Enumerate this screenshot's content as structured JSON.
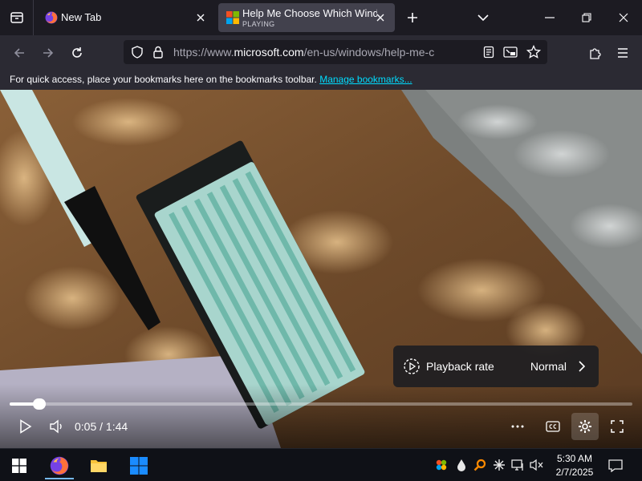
{
  "colors": {
    "tab_bg": "#1c1b22",
    "active_tab_bg": "#42414d",
    "toolbar_bg": "#2b2a33",
    "link": "#00ddff",
    "taskbar_bg": "#0f1117",
    "accent": "#76b9ed"
  },
  "tabs": [
    {
      "title": "New Tab",
      "icon": "firefox-icon",
      "active": false
    },
    {
      "title": "Help Me Choose Which Windows",
      "subtitle": "PLAYING",
      "icon": "microsoft-logo-icon",
      "active": true
    }
  ],
  "nav": {
    "url_prefix": "https://www.",
    "url_domain": "microsoft.com",
    "url_rest": "/en-us/windows/help-me-choose?"
  },
  "bookmarks": {
    "message": "For quick access, place your bookmarks here on the bookmarks toolbar.",
    "link": "Manage bookmarks..."
  },
  "video": {
    "progress": 0.048,
    "time": "0:05 / 1:44",
    "popover": {
      "label": "Playback rate",
      "value": "Normal"
    }
  },
  "taskbar": {
    "time": "5:30 AM",
    "date": "2/7/2025",
    "pinned": [
      "windows-start-icon",
      "firefox-icon",
      "file-explorer-icon",
      "windows-app-icon"
    ]
  }
}
